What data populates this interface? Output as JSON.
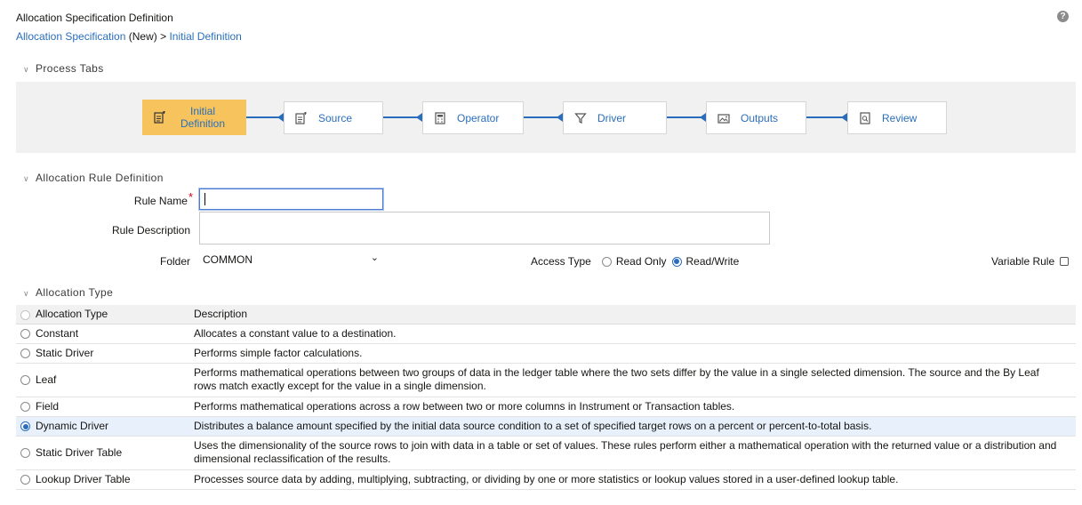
{
  "page": {
    "title": "Allocation Specification Definition",
    "help_icon": "?"
  },
  "breadcrumb": {
    "spec_link": "Allocation Specification",
    "status": "(New)",
    "separator": ">",
    "current_link": "Initial Definition"
  },
  "process_tabs": {
    "section_title": "Process Tabs",
    "tabs": [
      {
        "label_line1": "Initial",
        "label_line2": "Definition",
        "icon": "document-edit-icon",
        "active": true
      },
      {
        "label": "Source",
        "icon": "document-edit-icon",
        "active": false
      },
      {
        "label": "Operator",
        "icon": "calculator-icon",
        "active": false
      },
      {
        "label": "Driver",
        "icon": "filter-icon",
        "active": false
      },
      {
        "label": "Outputs",
        "icon": "image-icon",
        "active": false
      },
      {
        "label": "Review",
        "icon": "review-document-icon",
        "active": false
      }
    ]
  },
  "rule_definition": {
    "section_title": "Allocation Rule Definition",
    "rule_name_label": "Rule Name",
    "required_marker": "*",
    "rule_name_value": "",
    "rule_description_label": "Rule Description",
    "rule_description_value": "",
    "folder_label": "Folder",
    "folder_value": "COMMON",
    "access_type_label": "Access Type",
    "access_options": [
      {
        "label": "Read Only",
        "selected": false
      },
      {
        "label": "Read/Write",
        "selected": true
      }
    ],
    "variable_rule_label": "Variable Rule",
    "variable_rule_checked": false
  },
  "allocation_type": {
    "section_title": "Allocation Type",
    "columns": [
      "Allocation Type",
      "Description"
    ],
    "rows": [
      {
        "type": "Constant",
        "description": "Allocates a constant value to a destination.",
        "selected": false
      },
      {
        "type": "Static Driver",
        "description": "Performs simple factor calculations.",
        "selected": false
      },
      {
        "type": "Leaf",
        "description": "Performs mathematical operations between two groups of data in the ledger table where the two sets differ by the value in a single selected dimension. The source and the By Leaf rows match exactly except for the value in a single dimension.",
        "selected": false
      },
      {
        "type": "Field",
        "description": "Performs mathematical operations across a row between two or more columns in Instrument or Transaction tables.",
        "selected": false
      },
      {
        "type": "Dynamic Driver",
        "description": "Distributes a balance amount specified by the initial data source condition to a set of specified target rows on a percent or percent-to-total basis.",
        "selected": true
      },
      {
        "type": "Static Driver Table",
        "description": "Uses the dimensionality of the source rows to join with data in a table or set of values. These rules perform either a mathematical operation with the returned value or a distribution and dimensional reclassification of the results.",
        "selected": false
      },
      {
        "type": "Lookup Driver Table",
        "description": "Processes source data by adding, multiplying, subtracting, or dividing by one or more statistics or lookup values stored in a user-defined lookup table.",
        "selected": false
      }
    ]
  },
  "colors": {
    "accent": "#2a6ebb",
    "active_tab": "#f6c35c",
    "required": "#d0021b",
    "selected_row": "#e8f1fb"
  }
}
